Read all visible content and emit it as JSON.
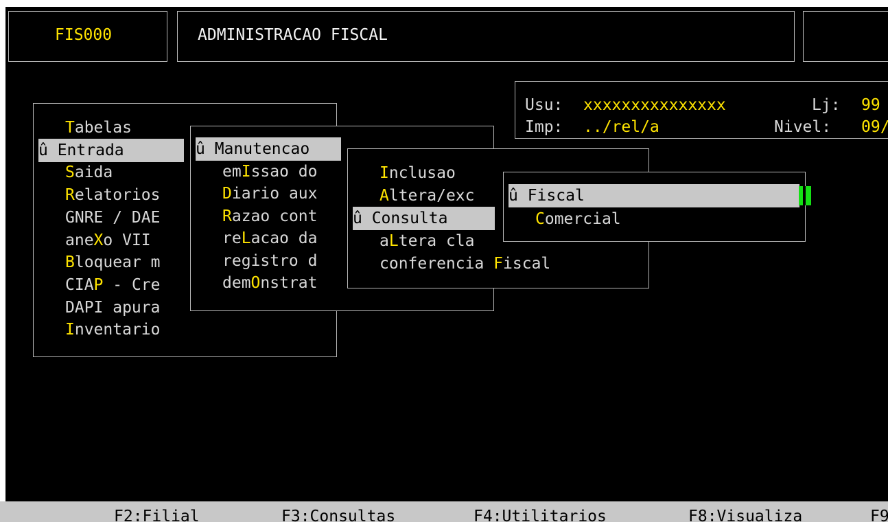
{
  "header": {
    "program_code": "FIS000",
    "title": "ADMINISTRACAO FISCAL"
  },
  "info": {
    "usu_label": "Usu:",
    "usu_value": "xxxxxxxxxxxxxxx",
    "lj_label": "Lj:",
    "lj_value": "99",
    "imp_label": "Imp:",
    "imp_value": "../rel/a",
    "nivel_label": "Nivel:",
    "nivel_value": "09/"
  },
  "selected_marker": "û",
  "menu1": {
    "items": [
      {
        "pre": "",
        "key": "T",
        "post": "abelas"
      },
      {
        "pre": "",
        "key": "",
        "post": "Entrada"
      },
      {
        "pre": "",
        "key": "S",
        "post": "aida"
      },
      {
        "pre": "",
        "key": "R",
        "post": "elatorios"
      },
      {
        "pre": "GNRE / DAE",
        "key": "",
        "post": ""
      },
      {
        "pre": "ane",
        "key": "X",
        "post": "o VII"
      },
      {
        "pre": "",
        "key": "B",
        "post": "loquear m"
      },
      {
        "pre": "CIA",
        "key": "P",
        "post": " - Cre"
      },
      {
        "pre": "DAPI apura",
        "key": "",
        "post": ""
      },
      {
        "pre": "",
        "key": "I",
        "post": "nventario"
      }
    ]
  },
  "menu2": {
    "items": [
      {
        "pre": "",
        "key": "",
        "post": "Manutencao"
      },
      {
        "pre": "em",
        "key": "I",
        "post": "ssao do"
      },
      {
        "pre": "",
        "key": "D",
        "post": "iario aux"
      },
      {
        "pre": "",
        "key": "R",
        "post": "azao cont"
      },
      {
        "pre": "re",
        "key": "L",
        "post": "acao da"
      },
      {
        "pre": "registro d",
        "key": "",
        "post": ""
      },
      {
        "pre": "dem",
        "key": "O",
        "post": "nstrat"
      }
    ]
  },
  "menu3": {
    "items": [
      {
        "pre": "",
        "key": "I",
        "post": "nclusao"
      },
      {
        "pre": "",
        "key": "A",
        "post": "ltera/exc"
      },
      {
        "pre": "",
        "key": "",
        "post": "Consulta"
      },
      {
        "pre": "a",
        "key": "L",
        "post": "tera cla"
      },
      {
        "pre": "conferencia ",
        "key": "F",
        "post": "iscal"
      }
    ]
  },
  "menu4": {
    "items": [
      {
        "pre": "",
        "key": "",
        "post": "Fiscal"
      },
      {
        "pre": "",
        "key": "C",
        "post": "omercial"
      }
    ]
  },
  "function_keys": [
    "F2:Filial",
    "F3:Consultas",
    "F4:Utilitarios",
    "F8:Visualiza",
    "F9"
  ],
  "colors": {
    "background": "#000000",
    "text": "#d8d8d8",
    "hotkey": "#ffe400",
    "selection_bg": "#c8c8c8",
    "cursor": "#15e015"
  }
}
